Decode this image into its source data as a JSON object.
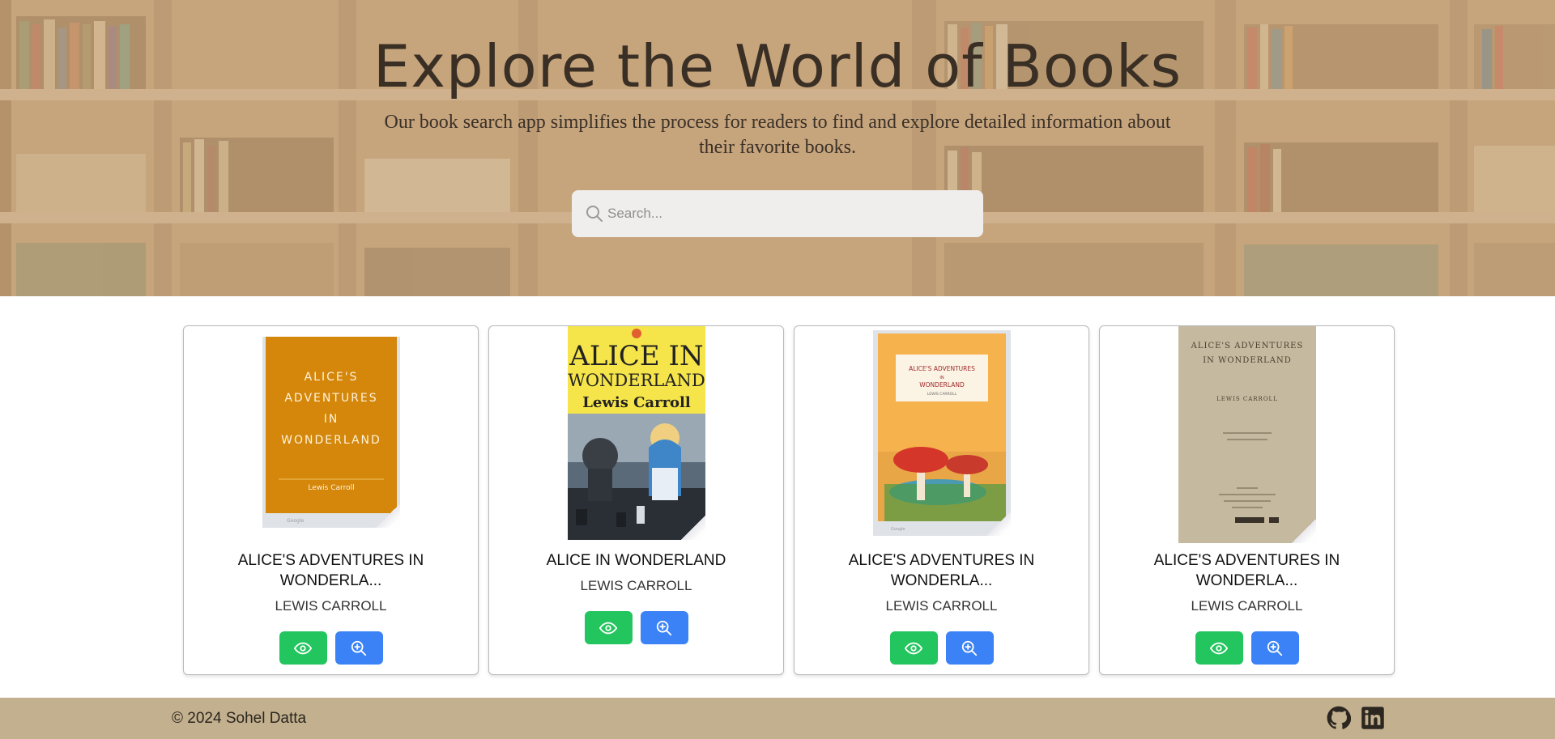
{
  "hero": {
    "title": "Explore the World of Books",
    "subtitle": "Our book search app simplifies the process for readers to find and explore detailed information about their favorite books.",
    "search": {
      "placeholder": "Search...",
      "value": ""
    }
  },
  "books": [
    {
      "title": "ALICE'S ADVENTURES IN WONDERLA...",
      "author": "LEWIS CARROLL",
      "cover": {
        "lines": [
          "ALICE'S",
          "ADVENTURES",
          "IN",
          "WONDERLAND"
        ],
        "byline": "Lewis Carroll",
        "color": "#d4870a"
      }
    },
    {
      "title": "ALICE IN WONDERLAND",
      "author": "LEWIS CARROLL",
      "cover": {
        "lines": [
          "ALICE IN",
          "WONDERLAND"
        ],
        "byline": "Lewis Carroll",
        "color": "#f6e54a"
      }
    },
    {
      "title": "ALICE'S ADVENTURES IN WONDERLA...",
      "author": "LEWIS CARROLL",
      "cover": {
        "lines": [
          "ALICE'S ADVENTURES",
          "IN",
          "WONDERLAND"
        ],
        "byline": "LEWIS CARROLL",
        "color": "#f6b24d"
      }
    },
    {
      "title": "ALICE'S ADVENTURES IN WONDERLA...",
      "author": "LEWIS CARROLL",
      "cover": {
        "lines": [
          "ALICE'S ADVENTURES",
          "IN WONDERLAND"
        ],
        "byline": "LEWIS CARROLL",
        "color": "#c9bfa5"
      }
    }
  ],
  "buttons": {
    "view_icon": "eye-icon",
    "zoom_icon": "zoom-in-icon",
    "view_color": "#22c55e",
    "zoom_color": "#3b82f6"
  },
  "footer": {
    "copyright": "© 2024 Sohel Datta",
    "icons": [
      "github-icon",
      "linkedin-icon"
    ],
    "background": "#c3b08e"
  }
}
